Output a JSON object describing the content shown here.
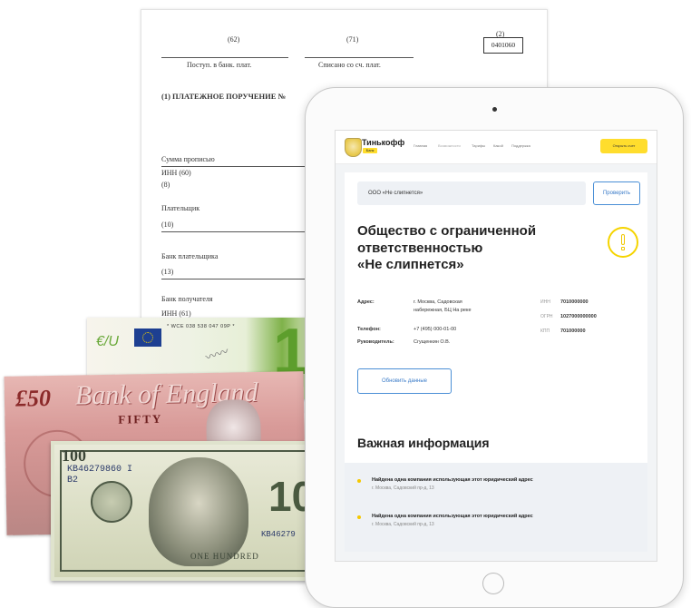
{
  "document": {
    "cell_62": "(62)",
    "cell_71": "(71)",
    "received_label": "Поступ. в банк. плат.",
    "debited_label": "Списано со сч. плат.",
    "form_code_num": "(2)",
    "form_code": "0401060",
    "title": "(1) ПЛАТЕЖНОЕ ПОРУЧЕНИЕ №",
    "amount_words": "Сумма прописью",
    "inn": "ИНН (60)",
    "field_8": "(8)",
    "payer": "Плательщик",
    "field_10": "(10)",
    "payer_bank": "Банк плательщика",
    "field_13": "(13)",
    "recipient_bank": "Банк получателя",
    "inn_61": "ИНН (61)"
  },
  "banknotes": {
    "euro_serial": "* WCE 038 538 047 09P *",
    "pound_value": "£50",
    "pound_bank": "Bank of England",
    "pound_fifty": "FIFTY",
    "dollar_value": "100",
    "dollar_serial": "KB46279860 I",
    "dollar_serial_b": "B2",
    "dollar_serial_right": "KB46279",
    "dollar_bottom": "ONE HUNDRED"
  },
  "header": {
    "logo_text": "Тинькофф",
    "logo_badge": "Банк",
    "nav": [
      "Главная",
      "Возможности",
      "Тарифы",
      "Какой",
      "Поддержка"
    ],
    "cta": "Открыть счет"
  },
  "search": {
    "company": "ООО «Не слипнется»",
    "check_label": "Проверить"
  },
  "company": {
    "title_line1": "Общество с ограниченной",
    "title_line2": "ответственностью",
    "title_line3": "«Не слипнется»",
    "address_label": "Адрес:",
    "address_line1": "г. Москва, Садовская",
    "address_line2": "набережная, БЦ На реке",
    "phone_label": "Телефон:",
    "phone": "+7 (495) 000-01-00",
    "director_label": "Руководитель:",
    "director": "Сгущенкин О.В.",
    "inn_label": "ИНН",
    "inn": "7010000000",
    "ogrn_label": "ОГРН",
    "ogrn": "1027000000000",
    "kpp_label": "КПП",
    "kpp": "701000000",
    "update_label": "Обновить данные"
  },
  "important": {
    "heading": "Важная информация",
    "items": [
      {
        "title": "Найдена одна компания использующая этот юридический адрес",
        "sub": "г. Москва, Садовский пр-д, 13"
      },
      {
        "title": "Найдена одна компания использующая этот юридический адрес",
        "sub": "г. Москва, Садовский пр-д, 13"
      }
    ]
  }
}
